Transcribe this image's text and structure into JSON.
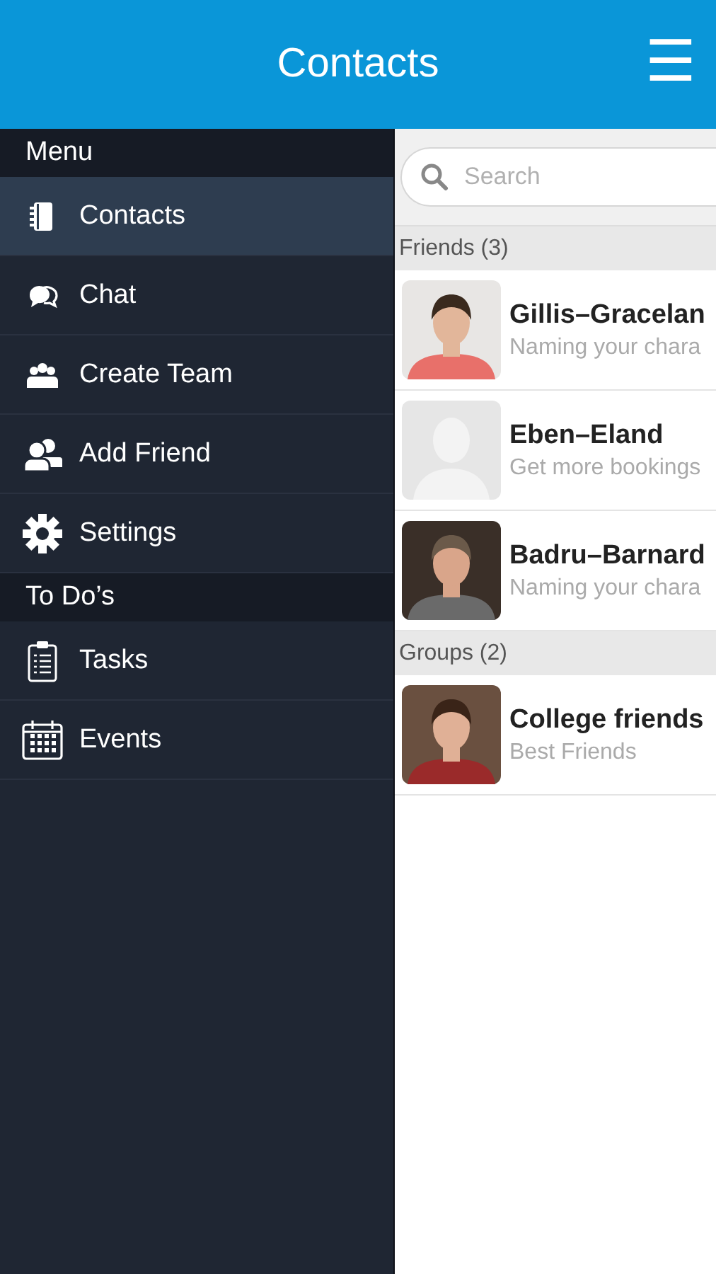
{
  "header": {
    "title": "Contacts",
    "menu_button": "☰"
  },
  "sidebar": {
    "sections": [
      {
        "title": "Menu",
        "items": [
          {
            "label": "Contacts",
            "selected": true
          },
          {
            "label": "Chat",
            "selected": false
          },
          {
            "label": "Create Team",
            "selected": false
          },
          {
            "label": "Add Friend",
            "selected": false
          },
          {
            "label": "Settings",
            "selected": false
          }
        ]
      },
      {
        "title": "To Do’s",
        "items": [
          {
            "label": "Tasks",
            "selected": false
          },
          {
            "label": "Events",
            "selected": false
          }
        ]
      }
    ]
  },
  "search": {
    "placeholder": "Search"
  },
  "groups": [
    {
      "title": "Friends (3)",
      "rows": [
        {
          "name": "Gillis–Gracelan",
          "subtitle": "Naming your chara",
          "kind": "picture"
        },
        {
          "name": "Eben–Eland",
          "subtitle": "Get more bookings",
          "kind": "placeholder"
        },
        {
          "name": "Badru–Barnard",
          "subtitle": "Naming your chara",
          "kind": "picture"
        }
      ]
    },
    {
      "title": "Groups (2)",
      "rows": [
        {
          "name": "College friends",
          "subtitle": "Best Friends",
          "kind": "picture"
        }
      ]
    }
  ]
}
